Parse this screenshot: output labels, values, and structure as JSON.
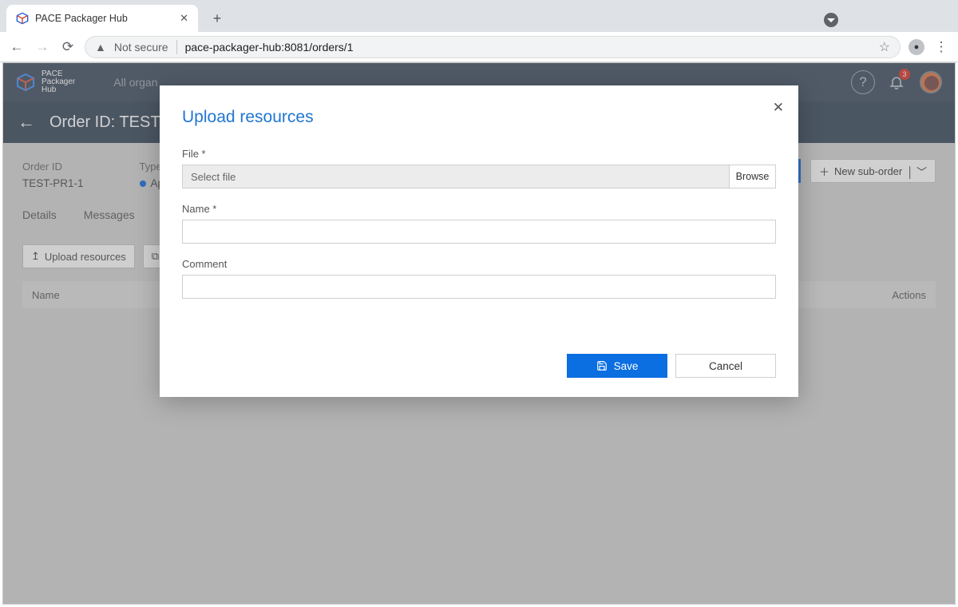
{
  "browser": {
    "tab_title": "PACE Packager Hub",
    "security_text": "Not secure",
    "url": "pace-packager-hub:8081/orders/1"
  },
  "app_header": {
    "brand_line1": "PACE",
    "brand_line2": "Packager",
    "brand_line3": "Hub",
    "org_link": "All organ",
    "notif_count": "3"
  },
  "subheader": {
    "title": "Order ID: TEST-"
  },
  "order_meta": {
    "order_id_label": "Order ID",
    "order_id_value": "TEST-PR1-1",
    "type_label": "Type",
    "type_value": "App Packag"
  },
  "right_buttons": {
    "new_suborder": "New sub-order"
  },
  "tabs": {
    "details": "Details",
    "messages": "Messages"
  },
  "toolbar": {
    "upload": "Upload resources"
  },
  "grid": {
    "col_name": "Name",
    "col_actions": "Actions"
  },
  "modal": {
    "title": "Upload resources",
    "file_label": "File *",
    "file_placeholder": "Select file",
    "browse": "Browse",
    "name_label": "Name *",
    "comment_label": "Comment",
    "save": "Save",
    "cancel": "Cancel"
  }
}
